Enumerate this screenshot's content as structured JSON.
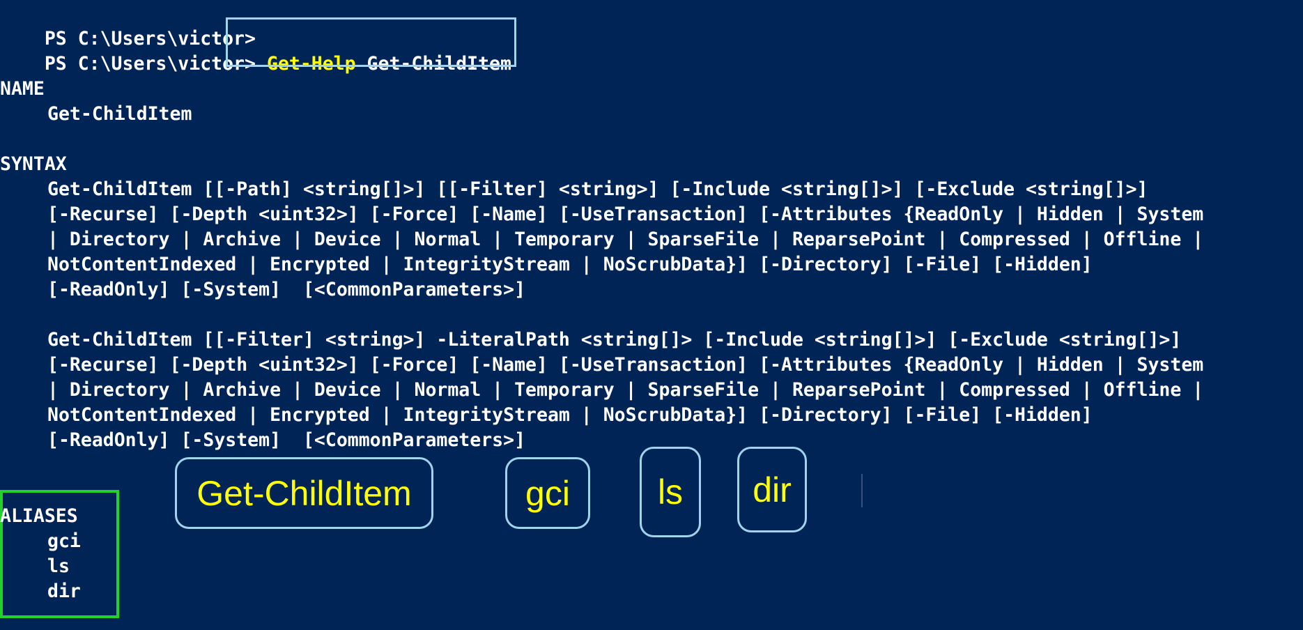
{
  "prompt": {
    "line1": "PS C:\\Users\\victor>",
    "line2": "PS C:\\Users\\victor>",
    "command_keyword": "Get-Help",
    "command_arg": " Get-ChildItem"
  },
  "sections": {
    "name_header": "NAME",
    "name_value": "Get-ChildItem",
    "syntax_header": "SYNTAX",
    "aliases_header": "ALIASES"
  },
  "syntax_block_1": [
    "Get-ChildItem [[-Path] <string[]>] [[-Filter] <string>] [-Include <string[]>] [-Exclude <string[]>]",
    "[-Recurse] [-Depth <uint32>] [-Force] [-Name] [-UseTransaction] [-Attributes {ReadOnly | Hidden | System",
    "| Directory | Archive | Device | Normal | Temporary | SparseFile | ReparsePoint | Compressed | Offline |",
    "NotContentIndexed | Encrypted | IntegrityStream | NoScrubData}] [-Directory] [-File] [-Hidden]",
    "[-ReadOnly] [-System]  [<CommonParameters>]"
  ],
  "syntax_block_2": [
    "Get-ChildItem [[-Filter] <string>] -LiteralPath <string[]> [-Include <string[]>] [-Exclude <string[]>]",
    "[-Recurse] [-Depth <uint32>] [-Force] [-Name] [-UseTransaction] [-Attributes {ReadOnly | Hidden | System",
    "| Directory | Archive | Device | Normal | Temporary | SparseFile | ReparsePoint | Compressed | Offline |",
    "NotContentIndexed | Encrypted | IntegrityStream | NoScrubData}] [-Directory] [-File] [-Hidden]",
    "[-ReadOnly] [-System]  [<CommonParameters>]"
  ],
  "aliases": [
    "gci",
    "ls",
    "dir"
  ],
  "callouts": [
    "Get-ChildItem",
    "gci",
    "ls",
    "dir"
  ],
  "colors": {
    "background": "#012456",
    "text": "#ffffff",
    "highlight": "#ffff00",
    "box_border": "#9fd4ea",
    "alias_frame": "#22d12a"
  }
}
